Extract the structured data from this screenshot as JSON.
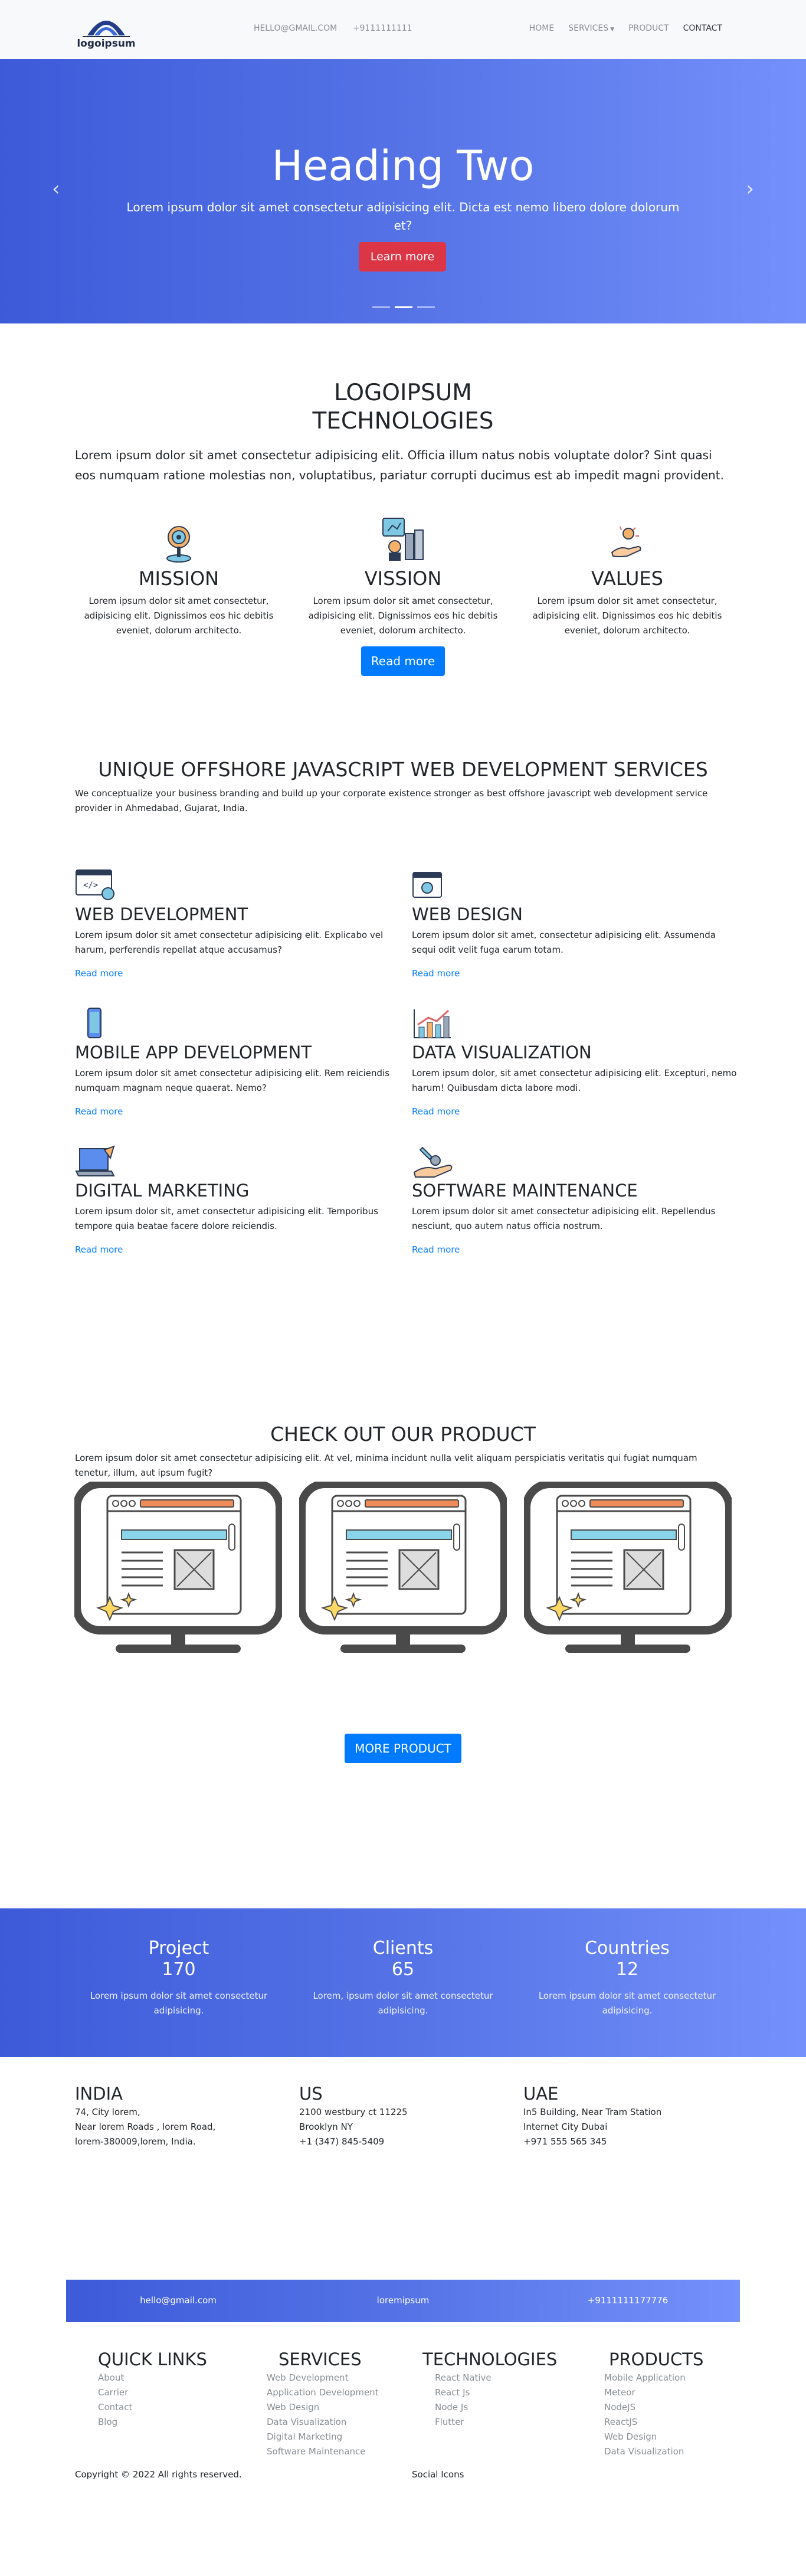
{
  "logo": {
    "text": "logoipsum"
  },
  "header": {
    "email": "HELLO@GMAIL.COM",
    "phone": "+9111111111",
    "nav": [
      "HOME",
      "SERVICES",
      "PRODUCT",
      "CONTACT"
    ]
  },
  "hero": {
    "title": "Heading Two",
    "text": "Lorem ipsum dolor sit amet consectetur adipisicing elit. Dicta est nemo libero dolore dolorum et?",
    "button": "Learn more",
    "prev_icon": "chevron-left-icon",
    "next_icon": "chevron-right-icon",
    "slides": 3,
    "active_slide": 2
  },
  "about": {
    "title_line1": "LOGOIPSUM",
    "title_line2": "TECHNOLOGIES",
    "desc": "Lorem ipsum dolor sit amet consectetur adipisicing elit. Officia illum natus nobis voluptate dolor? Sint quasi eos numquam ratione molestias non, voluptatibus, pariatur corrupti ducimus est ab impedit magni provident.",
    "features": [
      {
        "title": "MISSION",
        "icon": "target-icon",
        "text": "Lorem ipsum dolor sit amet consectetur, adipisicing elit. Dignissimos eos hic debitis eveniet, dolorum architecto."
      },
      {
        "title": "VISSION",
        "icon": "vision-board-icon",
        "text": "Lorem ipsum dolor sit amet consectetur, adipisicing elit. Dignissimos eos hic debitis eveniet, dolorum architecto."
      },
      {
        "title": "VALUES",
        "icon": "hand-coin-icon",
        "text": "Lorem ipsum dolor sit amet consectetur, adipisicing elit. Dignissimos eos hic debitis eveniet, dolorum architecto."
      }
    ],
    "button": "Read more"
  },
  "services": {
    "title": "UNIQUE OFFSHORE JAVASCRIPT WEB DEVELOPMENT SERVICES",
    "desc": "We conceptualize your business branding and build up your corporate existence stronger as best offshore javascript web development service provider in Ahmedabad, Gujarat, India.",
    "link": "Read more",
    "items": [
      {
        "title": "WEB DEVELOPMENT",
        "icon": "code-browser-icon",
        "text": "Lorem ipsum dolor sit amet consectetur adipisicing elit. Explicabo vel harum, perferendis repellat atque accusamus?"
      },
      {
        "title": "WEB DESIGN",
        "icon": "browser-design-icon",
        "text": "Lorem ipsum dolor sit amet, consectetur adipisicing elit. Assumenda sequi odit velit fuga earum totam."
      },
      {
        "title": "MOBILE APP DEVELOPMENT",
        "icon": "smartphone-icon",
        "text": "Lorem ipsum dolor sit amet consectetur adipisicing elit. Rem reiciendis numquam magnam neque quaerat. Nemo?"
      },
      {
        "title": "DATA VISUALIZATION",
        "icon": "bar-chart-icon",
        "text": "Lorem ipsum dolor, sit amet consectetur adipisicing elit. Excepturi, nemo harum! Quibusdam dicta labore modi."
      },
      {
        "title": "DIGITAL MARKETING",
        "icon": "laptop-marketing-icon",
        "text": "Lorem ipsum dolor sit, amet consectetur adipisicing elit. Temporibus tempore quia beatae facere dolore reiciendis."
      },
      {
        "title": "SOFTWARE MAINTENANCE",
        "icon": "wrench-hand-icon",
        "text": "Lorem ipsum dolor sit amet consectetur adipisicing elit. Repellendus nesciunt, quo autem natus officia nostrum."
      }
    ]
  },
  "product": {
    "title": "CHECK OUT OUR PRODUCT",
    "desc": "Lorem ipsum dolor sit amet consectetur adipisicing elit. At vel, minima incidunt nulla velit aliquam perspiciatis veritatis qui fugiat numquam tenetur, illum, aut ipsum fugit?",
    "image_icon": "monitor-webpage-icon",
    "button": "MORE PRODUCT"
  },
  "stats": [
    {
      "label": "Project",
      "value": "170",
      "text": "Lorem ipsum dolor sit amet consectetur adipisicing."
    },
    {
      "label": "Clients",
      "value": "65",
      "text": "Lorem, ipsum dolor sit amet consectetur adipisicing."
    },
    {
      "label": "Countries",
      "value": "12",
      "text": "Lorem ipsum dolor sit amet consectetur adipisicing."
    }
  ],
  "offices": [
    {
      "country": "INDIA",
      "lines": [
        "74, City lorem,",
        "Near lorem Roads , lorem Road,",
        "lorem-380009,lorem, India."
      ]
    },
    {
      "country": "US",
      "lines": [
        "2100 westbury ct 11225",
        "Brooklyn NY",
        "+1 (347) 845-5409"
      ]
    },
    {
      "country": "UAE",
      "lines": [
        "In5 Building, Near Tram Station",
        "Internet City Dubai",
        "+971 555 565 345"
      ]
    }
  ],
  "contact_bar": {
    "email": "hello@gmail.com",
    "brand": "loremipsum",
    "phone": "+9111111177776"
  },
  "footer": {
    "columns": [
      {
        "title": "QUICK LINKS",
        "links": [
          "About",
          "Carrier",
          "Contact",
          "Blog"
        ]
      },
      {
        "title": "SERVICES",
        "links": [
          "Web Development",
          "Application Development",
          "Web Design",
          "Data Visualization",
          "Digital Marketing",
          "Software Maintenance"
        ]
      },
      {
        "title": "TECHNOLOGIES",
        "links": [
          "React Native",
          "React Js",
          "Node Js",
          "Flutter"
        ]
      },
      {
        "title": "PRODUCTS",
        "links": [
          "Mobile Application",
          "Meteor",
          "NodeJS",
          "ReactJS",
          "Web Design",
          "Data Visualization"
        ]
      }
    ],
    "copyright": "Copyright © 2022 All rights reserved.",
    "social": "Social Icons"
  },
  "colors": {
    "primary": "#007bff",
    "danger": "#dc3545",
    "gradient_start": "#3d5bd9",
    "gradient_end": "#7490fb"
  }
}
